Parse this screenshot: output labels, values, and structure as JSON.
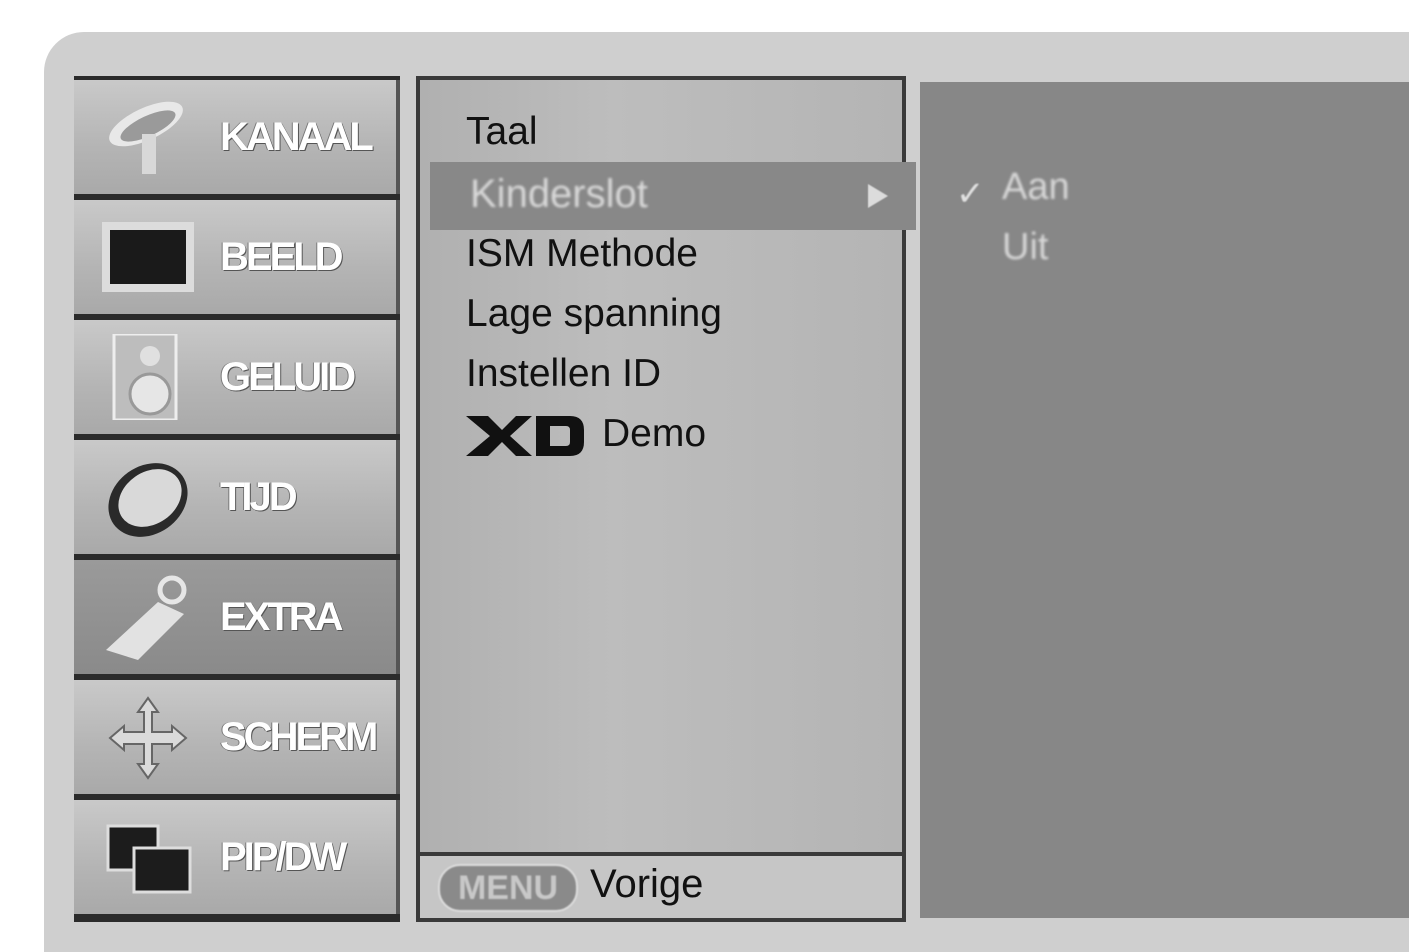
{
  "sidebar": {
    "items": [
      {
        "label": "KANAAL",
        "icon": "satellite-dish-icon",
        "active": false
      },
      {
        "label": "BEELD",
        "icon": "picture-icon",
        "active": false
      },
      {
        "label": "GELUID",
        "icon": "speaker-icon",
        "active": false
      },
      {
        "label": "TIJD",
        "icon": "clock-icon",
        "active": false
      },
      {
        "label": "EXTRA",
        "icon": "tag-icon",
        "active": true
      },
      {
        "label": "SCHERM",
        "icon": "move-arrows-icon",
        "active": false
      },
      {
        "label": "PIP/DW",
        "icon": "pip-icon",
        "active": false
      }
    ]
  },
  "menu": {
    "items": [
      {
        "label": "Taal"
      },
      {
        "label": "Kinderslot",
        "selected": true
      },
      {
        "label": "ISM Methode"
      },
      {
        "label": "Lage spanning"
      },
      {
        "label": "Instellen ID"
      },
      {
        "label": "Demo",
        "prefix_logo": "XD"
      }
    ],
    "footer": {
      "key": "MENU",
      "label": "Vorige"
    }
  },
  "submenu": {
    "options": [
      {
        "label": "Aan",
        "checked": true
      },
      {
        "label": "Uit",
        "checked": false
      }
    ]
  }
}
